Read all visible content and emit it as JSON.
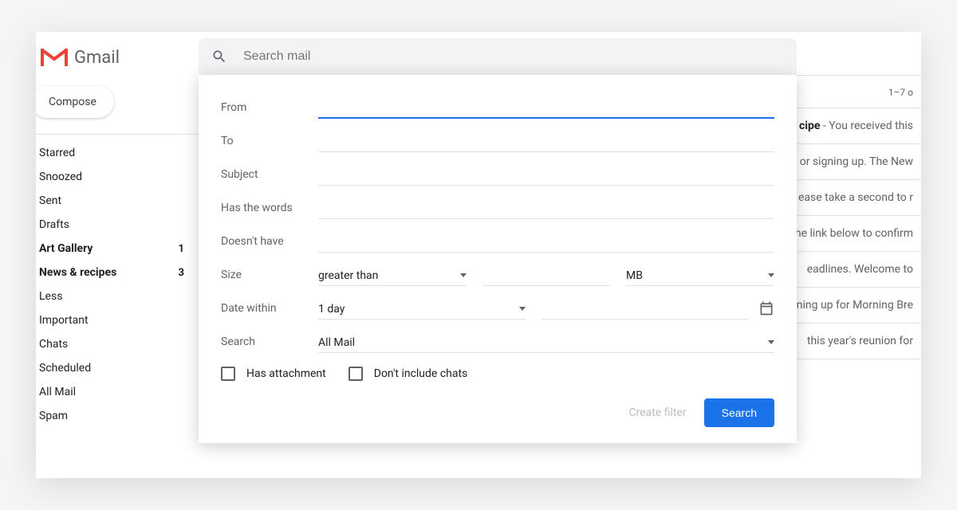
{
  "brand": "Gmail",
  "search": {
    "placeholder": "Search mail"
  },
  "compose": "Compose",
  "sidebar": {
    "items": [
      {
        "label": "Starred",
        "bold": false,
        "count": ""
      },
      {
        "label": "Snoozed",
        "bold": false,
        "count": ""
      },
      {
        "label": "Sent",
        "bold": false,
        "count": ""
      },
      {
        "label": "Drafts",
        "bold": false,
        "count": ""
      },
      {
        "label": "Art Gallery",
        "bold": true,
        "count": "1"
      },
      {
        "label": "News & recipes",
        "bold": true,
        "count": "3"
      },
      {
        "label": "Less",
        "bold": false,
        "count": ""
      },
      {
        "label": "Important",
        "bold": false,
        "count": ""
      },
      {
        "label": "Chats",
        "bold": false,
        "count": ""
      },
      {
        "label": "Scheduled",
        "bold": false,
        "count": ""
      },
      {
        "label": "All Mail",
        "bold": false,
        "count": ""
      },
      {
        "label": "Spam",
        "bold": false,
        "count": ""
      }
    ]
  },
  "header": {
    "count": "1–7 o"
  },
  "emails": [
    {
      "subject": "cipe",
      "snippet": " - You received this"
    },
    {
      "subject": "",
      "snippet": "or signing up. The New "
    },
    {
      "subject": "",
      "snippet": "ease take a second to r"
    },
    {
      "subject": "",
      "snippet": "he link below to confirm"
    },
    {
      "subject": "",
      "snippet": "eadlines. Welcome to "
    },
    {
      "subject": "",
      "snippet": "ning up for Morning Bre"
    },
    {
      "subject": "",
      "snippet": " this year's reunion for"
    }
  ],
  "adv": {
    "from": "From",
    "to": "To",
    "subject": "Subject",
    "has_words": "Has the words",
    "doesnt_have": "Doesn't have",
    "size": "Size",
    "size_op": "greater than",
    "size_unit": "MB",
    "date_within": "Date within",
    "date_val": "1 day",
    "search_label": "Search",
    "search_val": "All Mail",
    "has_attachment": "Has attachment",
    "dont_include_chats": "Don't include chats",
    "create_filter": "Create filter",
    "search_btn": "Search"
  }
}
